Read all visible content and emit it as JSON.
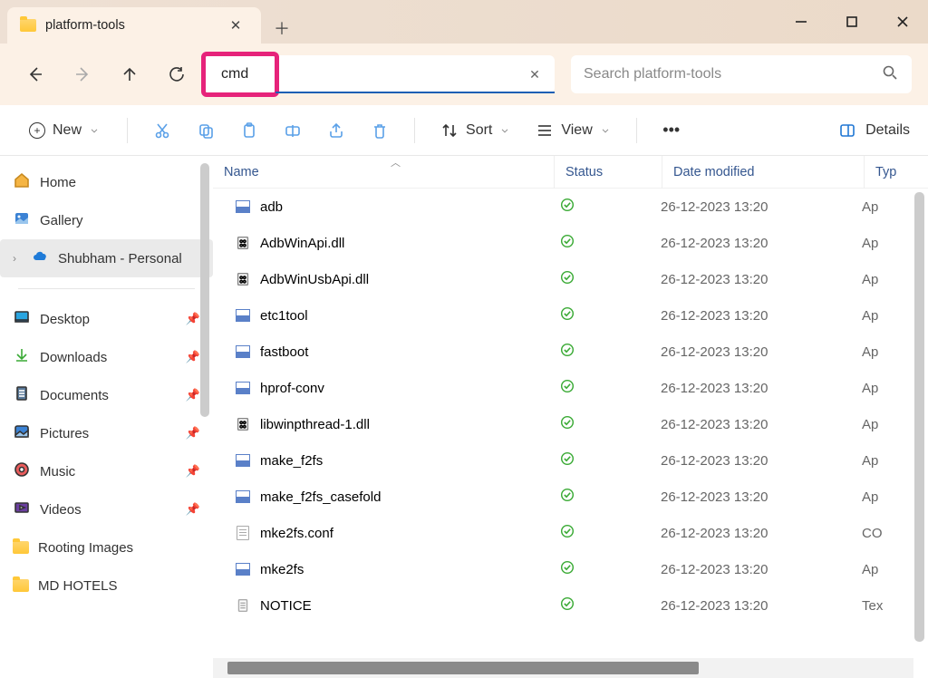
{
  "window": {
    "tab_title": "platform-tools"
  },
  "nav": {
    "address_value": "cmd",
    "search_placeholder": "Search platform-tools"
  },
  "toolbar": {
    "new": "New",
    "sort": "Sort",
    "view": "View",
    "details": "Details"
  },
  "sidebar": {
    "home": "Home",
    "gallery": "Gallery",
    "onedrive": "Shubham - Personal",
    "desktop": "Desktop",
    "downloads": "Downloads",
    "documents": "Documents",
    "pictures": "Pictures",
    "music": "Music",
    "videos": "Videos",
    "folder1": "Rooting Images",
    "folder2": "MD HOTELS"
  },
  "columns": {
    "name": "Name",
    "status": "Status",
    "date": "Date modified",
    "type": "Typ"
  },
  "files": [
    {
      "name": "adb",
      "date": "26-12-2023 13:20",
      "type": "Ap",
      "icon": "app"
    },
    {
      "name": "AdbWinApi.dll",
      "date": "26-12-2023 13:20",
      "type": "Ap",
      "icon": "dll"
    },
    {
      "name": "AdbWinUsbApi.dll",
      "date": "26-12-2023 13:20",
      "type": "Ap",
      "icon": "dll"
    },
    {
      "name": "etc1tool",
      "date": "26-12-2023 13:20",
      "type": "Ap",
      "icon": "app"
    },
    {
      "name": "fastboot",
      "date": "26-12-2023 13:20",
      "type": "Ap",
      "icon": "app"
    },
    {
      "name": "hprof-conv",
      "date": "26-12-2023 13:20",
      "type": "Ap",
      "icon": "app"
    },
    {
      "name": "libwinpthread-1.dll",
      "date": "26-12-2023 13:20",
      "type": "Ap",
      "icon": "dll"
    },
    {
      "name": "make_f2fs",
      "date": "26-12-2023 13:20",
      "type": "Ap",
      "icon": "app"
    },
    {
      "name": "make_f2fs_casefold",
      "date": "26-12-2023 13:20",
      "type": "Ap",
      "icon": "app"
    },
    {
      "name": "mke2fs.conf",
      "date": "26-12-2023 13:20",
      "type": "CO",
      "icon": "txt"
    },
    {
      "name": "mke2fs",
      "date": "26-12-2023 13:20",
      "type": "Ap",
      "icon": "app"
    },
    {
      "name": "NOTICE",
      "date": "26-12-2023 13:20",
      "type": "Tex",
      "icon": "doc"
    }
  ]
}
